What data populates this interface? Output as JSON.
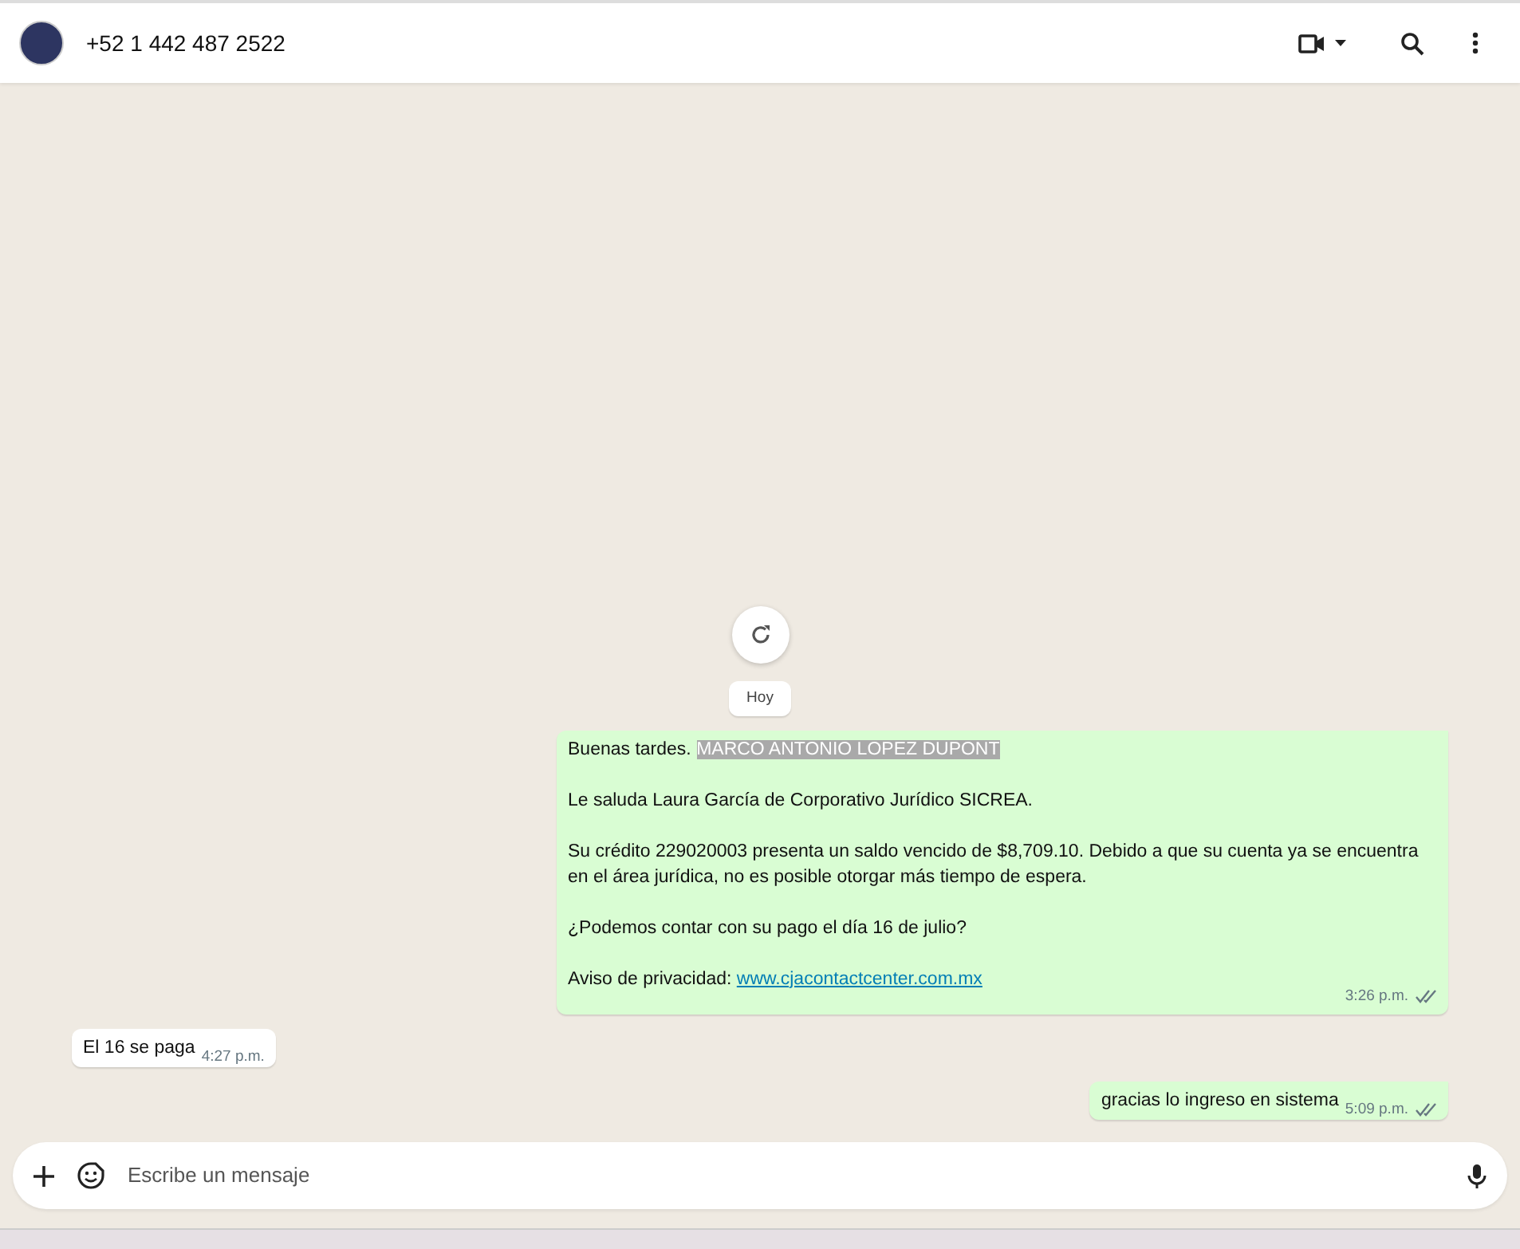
{
  "header": {
    "contact": "+52 1 442 487 2522"
  },
  "date_chip": "Hoy",
  "messages": [
    {
      "kind": "outgoing",
      "read": true,
      "time": "3:26 p.m.",
      "paragraphs": [
        [
          {
            "kind": "plain",
            "text": "Buenas tardes. "
          },
          {
            "kind": "highlight",
            "text": "MARCO ANTONIO LOPEZ DUPONT"
          }
        ],
        [
          {
            "kind": "plain",
            "text": "Le saluda Laura García de Corporativo Jurídico SICREA."
          }
        ],
        [
          {
            "kind": "plain",
            "text": "Su crédito 229020003 presenta un saldo vencido de $8,709.10. Debido a que su cuenta ya se encuentra en el área jurídica, no es posible otorgar más tiempo de espera."
          }
        ],
        [
          {
            "kind": "plain",
            "text": "¿Podemos contar con su pago el día 16 de julio?"
          }
        ],
        [
          {
            "kind": "plain",
            "text": "Aviso de privacidad: "
          },
          {
            "kind": "link",
            "text": "www.cjacontactcenter.com.mx"
          }
        ]
      ]
    },
    {
      "kind": "incoming",
      "time": "4:27 p.m.",
      "paragraphs": [
        [
          {
            "kind": "plain",
            "text": "El 16 se paga"
          }
        ]
      ]
    },
    {
      "kind": "outgoing",
      "read": true,
      "time": "5:09 p.m.",
      "paragraphs": [
        [
          {
            "kind": "plain",
            "text": "gracias lo ingreso en sistema"
          }
        ]
      ]
    }
  ],
  "composer": {
    "placeholder": "Escribe un mensaje"
  }
}
